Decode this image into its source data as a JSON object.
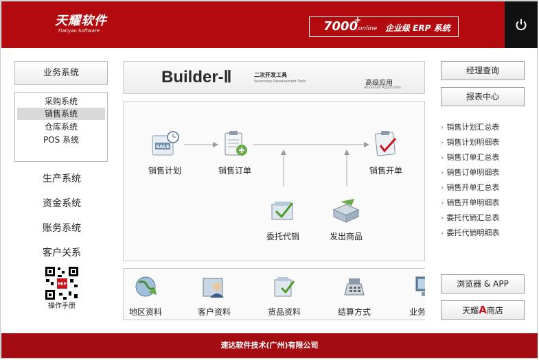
{
  "header": {
    "logo_cn": "天耀软件",
    "logo_en": "Tianyao Software",
    "erp_number": "7000",
    "erp_plus": "+",
    "erp_online": ".online",
    "erp_text": "企业级 ERP 系统",
    "brand_color": "#b20a0f"
  },
  "sidebar": {
    "business_label": "业务系统",
    "sub_items": [
      "采购系统",
      "销售系统",
      "仓库系统",
      "POS 系统"
    ],
    "selected_index": 1,
    "links": [
      "生产系统",
      "资金系统",
      "账务系统",
      "客户关系"
    ],
    "manual_label": "操作手册"
  },
  "banner": {
    "title": "Builder-Ⅱ",
    "sub_cn": "二次开发工具",
    "sub_en": "Secondary Development Tools",
    "adv_cn": "高级应用",
    "adv_en": "Advanced Application"
  },
  "flow": {
    "plan": "销售计划",
    "order": "销售订单",
    "invoice": "销售开单",
    "consign": "委托代销",
    "ship": "发出商品"
  },
  "bottom": {
    "items": [
      "地区资料",
      "客户资料",
      "货品资料",
      "结算方式",
      "业务资料"
    ]
  },
  "right": {
    "manager_query": "经理查询",
    "report_center": "报表中心",
    "links": [
      "销售计划汇总表",
      "销售计划明细表",
      "销售订单汇总表",
      "销售订单明细表",
      "销售开单汇总表",
      "销售开单明细表",
      "委托代销汇总表",
      "委托代销明细表"
    ],
    "browser_app": "浏览器 & APP",
    "store_prefix": "天耀",
    "store_logo": "A",
    "store_suffix": "商店"
  },
  "footer": {
    "company": "速达软件技术(广州)有限公司"
  }
}
